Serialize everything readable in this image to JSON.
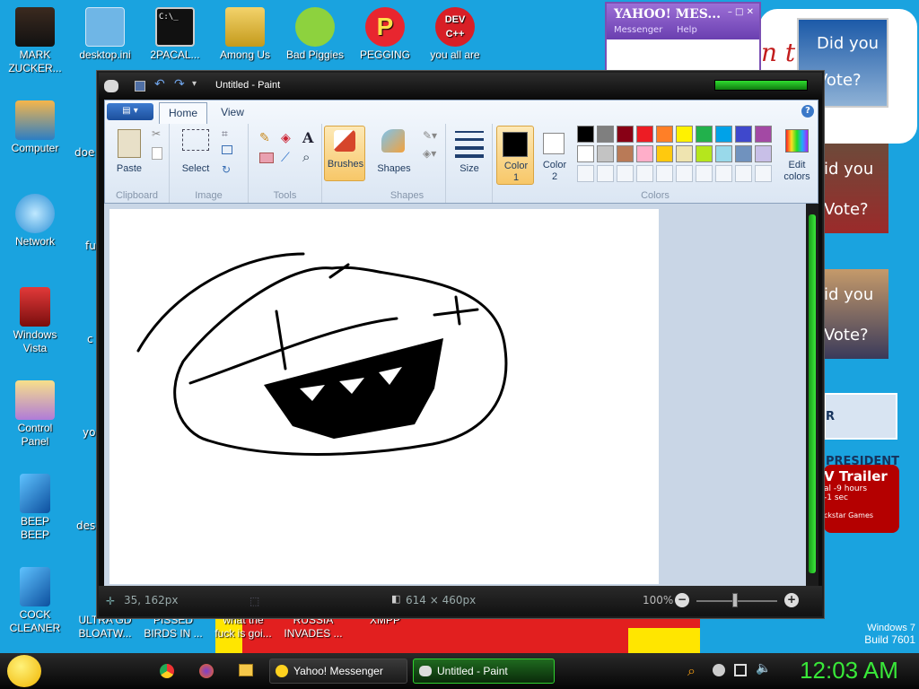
{
  "desktop": {
    "top_row": [
      {
        "label": "MARK\nZUCKER...",
        "icon": "person-icon"
      },
      {
        "label": "desktop.ini",
        "icon": "settings-file-icon"
      },
      {
        "label": "2PACAL...",
        "icon": "console-icon"
      },
      {
        "label": "Among Us",
        "icon": "game-icon"
      },
      {
        "label": "Bad Piggies",
        "icon": "pig-icon"
      },
      {
        "label": "PEGGING",
        "icon": "p-logo-icon"
      },
      {
        "label": "you all are",
        "icon": "devcpp-icon"
      }
    ],
    "left_column": [
      {
        "label": "Computer",
        "icon": "computer-icon"
      },
      {
        "label": "Network",
        "icon": "network-icon"
      },
      {
        "label": "Windows\nVista",
        "icon": "recycle-bin-icon"
      },
      {
        "label": "Control\nPanel",
        "icon": "control-panel-icon"
      },
      {
        "label": "BEEP\nBEEP",
        "icon": "blue-file-icon"
      },
      {
        "label": "COCK\nCLEANER",
        "icon": "blue-file-icon"
      }
    ],
    "second_column_partial": [
      "doe",
      "fu",
      "c",
      "yo",
      "des"
    ],
    "bottom_row": [
      {
        "label": "ULTRA GD\nBLOATW..."
      },
      {
        "label": "PISSED\nBIRDS IN ..."
      },
      {
        "label": "what the\nfuck is goi..."
      },
      {
        "label": "RUSSIA\nINVADES ..."
      },
      {
        "label": "XMPP"
      }
    ],
    "watermark": {
      "line1": "Windows 7",
      "line2": "Build 7601"
    },
    "ad_texts": [
      "Did you",
      "Vote?",
      "id you",
      "Vote?",
      "id you",
      "Vote?",
      "R PRESIDENT",
      "V Trailer",
      "al -9 hours",
      "-1 sec",
      "ckstar Games",
      "n t"
    ]
  },
  "yahoo": {
    "title": "YAHOO! MES...",
    "menu1": "Messenger",
    "menu2": "Help"
  },
  "paint": {
    "title": "Untitled - Paint",
    "tabs": {
      "home": "Home",
      "view": "View"
    },
    "groups": {
      "clipboard": "Clipboard",
      "image": "Image",
      "tools": "Tools",
      "shapes": "Shapes",
      "colors": "Colors"
    },
    "buttons": {
      "paste": "Paste",
      "select": "Select",
      "brushes": "Brushes",
      "shapes": "Shapes",
      "size": "Size",
      "color1": "Color\n1",
      "color2": "Color\n2",
      "edit_colors": "Edit\ncolors"
    },
    "palette_row1": [
      "#000000",
      "#7f7f7f",
      "#880015",
      "#ed1c24",
      "#ff7f27",
      "#fff200",
      "#22b14c",
      "#00a2e8",
      "#3f48cc",
      "#a349a4"
    ],
    "palette_row2": [
      "#ffffff",
      "#c3c3c3",
      "#b97a57",
      "#ffaec9",
      "#ffc90e",
      "#efe4b0",
      "#b5e61d",
      "#99d9ea",
      "#7092be",
      "#c8bfe7"
    ],
    "color1": "#000000",
    "color2": "#ffffff",
    "status": {
      "cursor": "35, 162px",
      "size": "614 × 460px",
      "zoom": "100%"
    }
  },
  "taskbar": {
    "items": [
      {
        "label": "Yahoo! Messenger",
        "icon": "yahoo-icon"
      },
      {
        "label": "Untitled - Paint",
        "icon": "paint-icon"
      }
    ],
    "clock": "12:03 AM"
  }
}
